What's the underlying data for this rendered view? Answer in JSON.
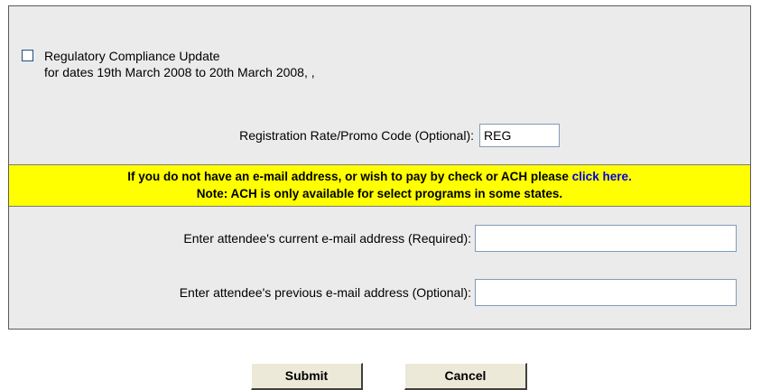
{
  "course": {
    "checked": false,
    "title": "Regulatory Compliance Update",
    "dates": "for dates 19th March 2008 to 20th March 2008, ,"
  },
  "promo": {
    "label": "Registration Rate/Promo Code (Optional):",
    "value": "REG"
  },
  "notice": {
    "line1": "If you do not have an e-mail address, or wish to pay by check or ACH please",
    "link": "click here.",
    "line2": "Note: ACH is only available for select programs in some states.",
    "bg_color": "#ffff00",
    "link_color": "#0000e0"
  },
  "email": {
    "current_label": "Enter attendee's current e-mail address (Required):",
    "current_value": "",
    "previous_label": "Enter attendee's previous e-mail address (Optional):",
    "previous_value": ""
  },
  "buttons": {
    "submit": "Submit",
    "cancel": "Cancel"
  }
}
